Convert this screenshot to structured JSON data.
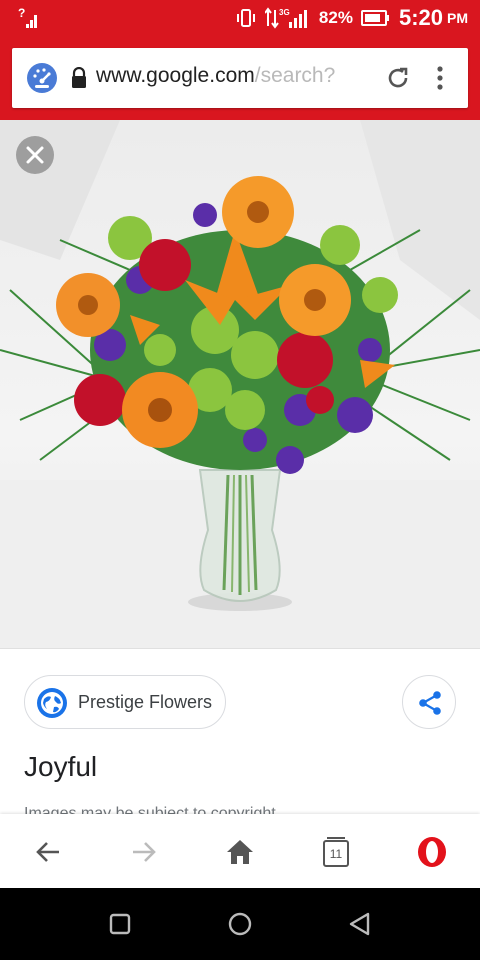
{
  "status_bar": {
    "sim_indicator": "?",
    "network": "3G",
    "battery": "82%",
    "time": "5:20",
    "ampm": "PM"
  },
  "address_bar": {
    "url_main": "www.google.com",
    "url_faded": "/search?"
  },
  "image": {
    "subject": "bouquet of orange gerberas, orange lilies, red carnations, green chrysanthemums and purple statice in a glass vase"
  },
  "result": {
    "source_name": "Prestige Flowers",
    "title": "Joyful",
    "note": "Images may be subject to copyright."
  },
  "toolbar": {
    "tab_count": "11"
  },
  "colors": {
    "accent": "#d9161f",
    "opera": "#e3121b",
    "share_blue": "#1a73e8"
  }
}
